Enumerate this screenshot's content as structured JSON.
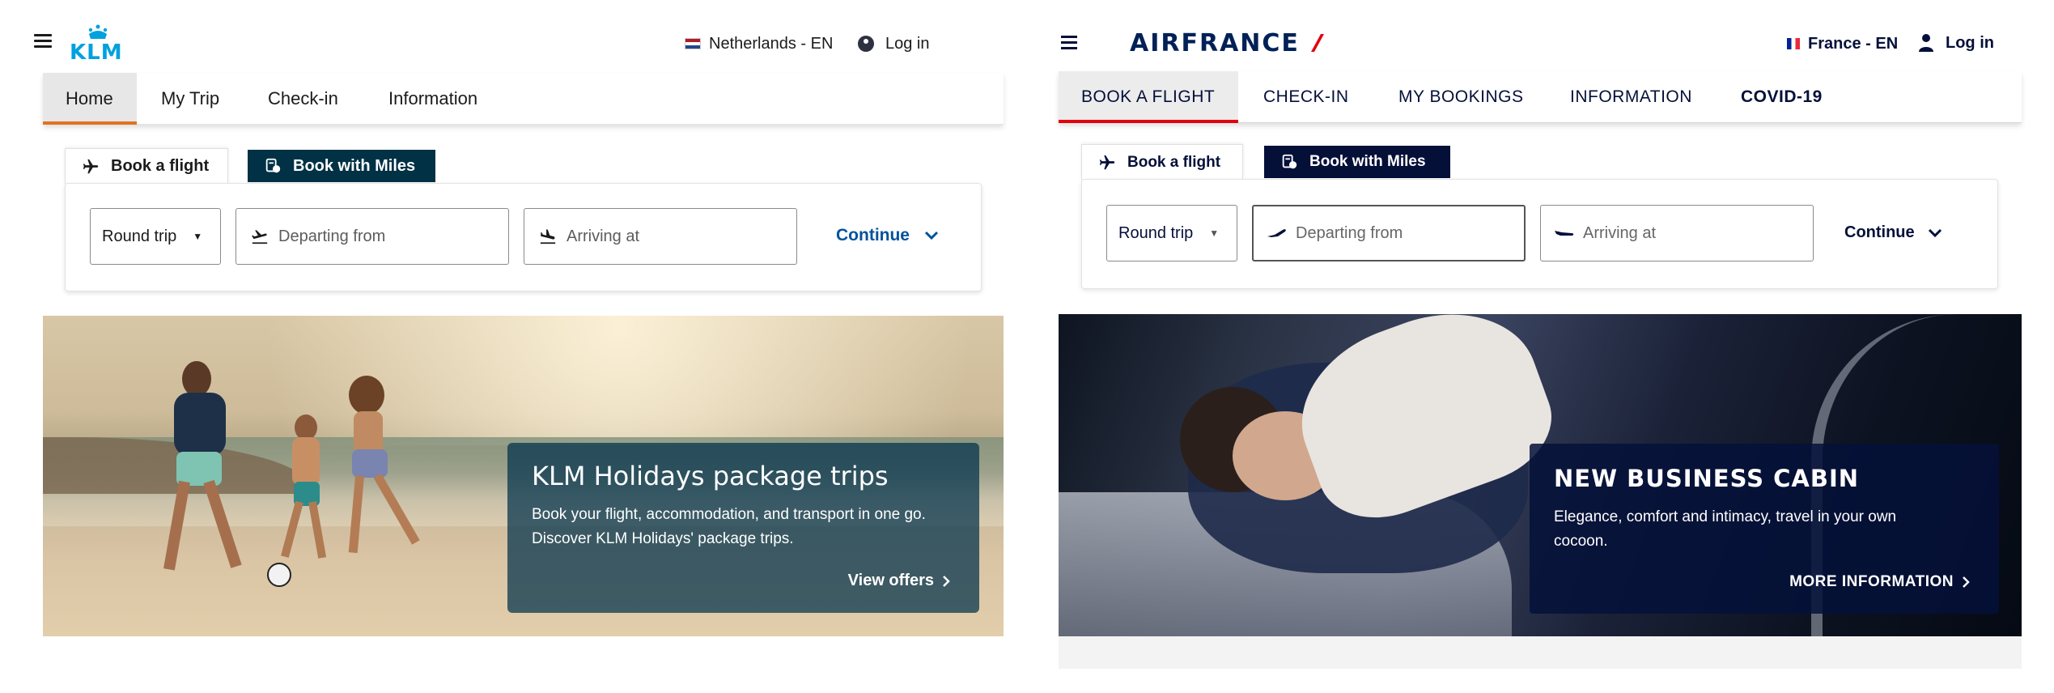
{
  "klm": {
    "brand": "KLM",
    "locale": "Netherlands - EN",
    "login": "Log in",
    "nav": [
      "Home",
      "My Trip",
      "Check-in",
      "Information"
    ],
    "tabs": {
      "book": "Book a flight",
      "miles": "Book with Miles"
    },
    "form": {
      "trip_type": "Round trip",
      "from_placeholder": "Departing from",
      "to_placeholder": "Arriving at",
      "continue": "Continue"
    },
    "promo": {
      "title": "KLM Holidays package trips",
      "text_line1": "Book your flight, accommodation, and transport in one go.",
      "text_line2": "Discover KLM Holidays' package trips.",
      "cta": "View offers"
    },
    "colors": {
      "accent": "#00a1de",
      "nav_active": "#e37222",
      "tab_dark": "#003145"
    }
  },
  "af": {
    "brand": "AIRFRANCE",
    "locale": "France - EN",
    "login": "Log in",
    "nav": [
      "BOOK A FLIGHT",
      "CHECK-IN",
      "MY BOOKINGS",
      "INFORMATION",
      "COVID-19"
    ],
    "tabs": {
      "book": "Book a flight",
      "miles": "Book with Miles"
    },
    "form": {
      "trip_type": "Round trip",
      "from_placeholder": "Departing from",
      "to_placeholder": "Arriving at",
      "continue": "Continue"
    },
    "promo": {
      "title": "NEW BUSINESS CABIN",
      "text_line1": "Elegance, comfort and intimacy, travel in your own",
      "text_line2": "cocoon.",
      "cta": "MORE INFORMATION"
    },
    "colors": {
      "navy": "#051039",
      "nav_active": "#e1000f"
    }
  }
}
